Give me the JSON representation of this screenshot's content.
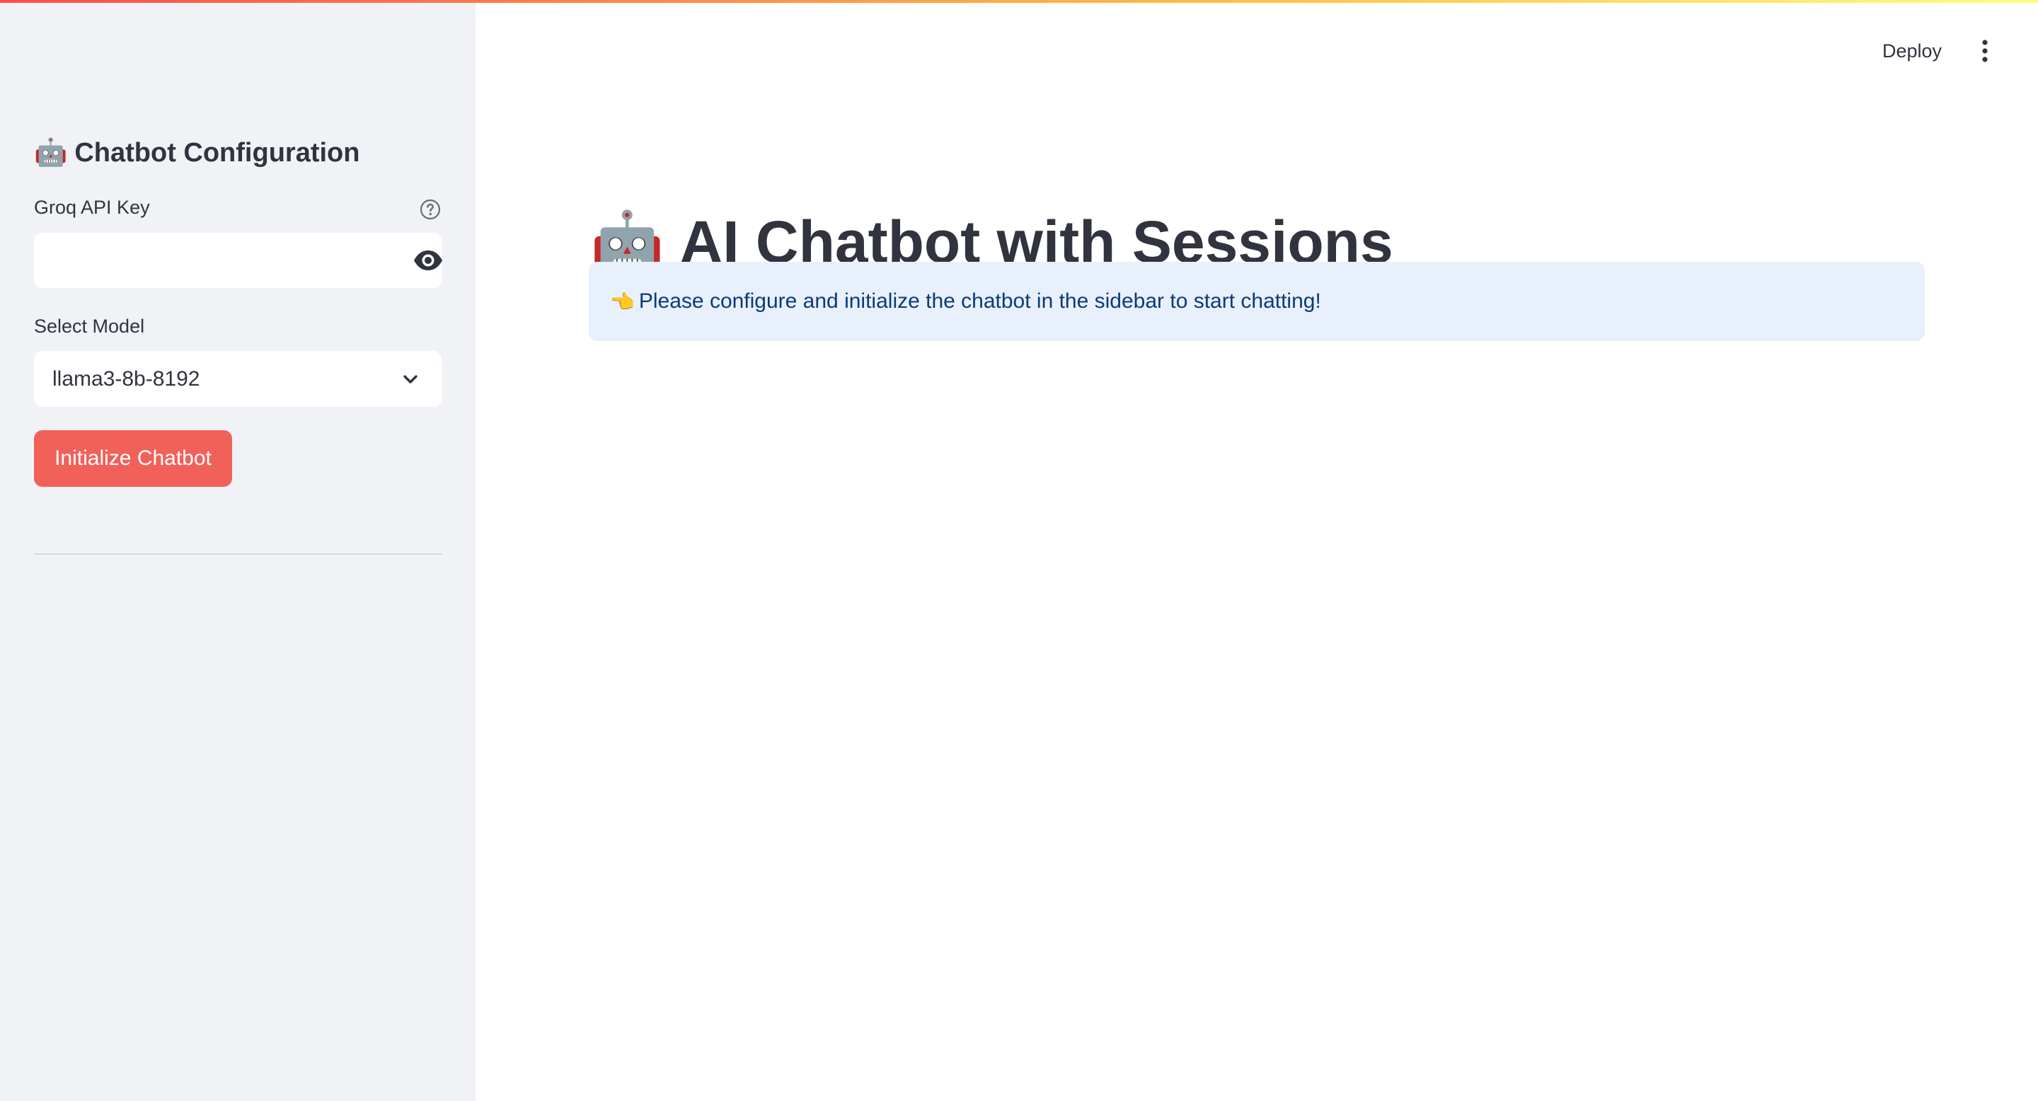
{
  "sidebar": {
    "title_emoji": "🤖",
    "title": "Chatbot Configuration",
    "api_key_label": "Groq API Key",
    "api_key_value": "",
    "model_label": "Select Model",
    "model_value": "llama3-8b-8192",
    "init_button_label": "Initialize Chatbot"
  },
  "header": {
    "deploy_label": "Deploy"
  },
  "main": {
    "title_emoji": "🤖",
    "title": "AI Chatbot with Sessions",
    "info_emoji": "👈",
    "info_message": "Please configure and initialize the chatbot in the sidebar to start chatting!"
  },
  "colors": {
    "primary": "#f2605a",
    "sidebar_bg": "#f0f2f6",
    "info_bg": "#e8f0fb",
    "info_text": "#0b3a7a",
    "text": "#31333f"
  }
}
